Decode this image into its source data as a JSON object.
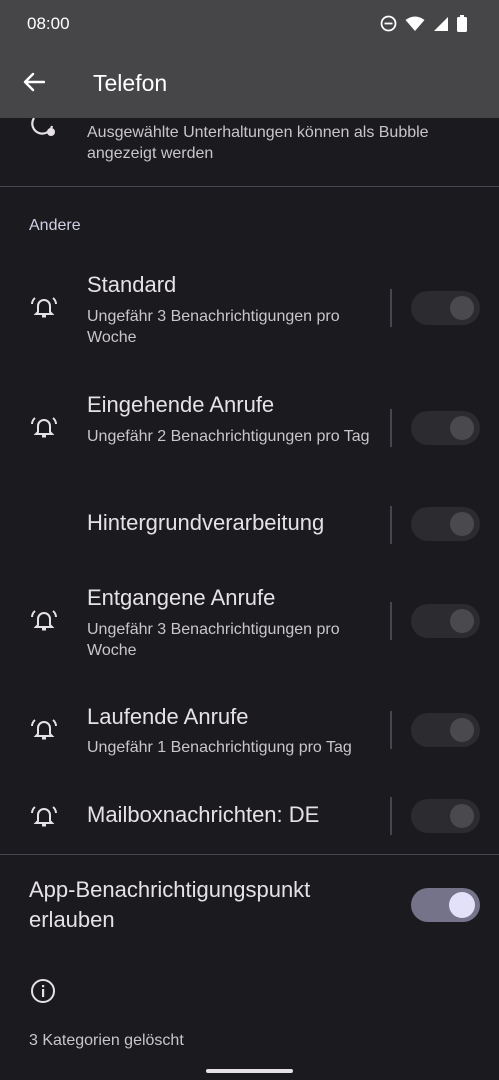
{
  "status_bar": {
    "time": "08:00",
    "icons": [
      "do-not-disturb-icon",
      "wifi-icon",
      "signal-icon",
      "battery-icon"
    ]
  },
  "app_bar": {
    "title": "Telefon",
    "back_icon": "arrow-back-icon"
  },
  "bubbles_row": {
    "icon": "bubble-icon",
    "text": "Ausgewählte Unterhaltungen können als Bubble angezeigt werden"
  },
  "section": {
    "header": "Andere"
  },
  "channels": [
    {
      "icon": "bell-icon",
      "title": "Standard",
      "subtitle": "Ungefähr 3 Benachrichtigungen pro Woche",
      "enabled": false
    },
    {
      "icon": "bell-icon",
      "title": "Eingehende Anrufe",
      "subtitle": "Ungefähr 2 Benachrichtigungen pro Tag",
      "enabled": false
    },
    {
      "icon": "",
      "title": "Hintergrundverarbeitung",
      "subtitle": "",
      "enabled": false
    },
    {
      "icon": "bell-icon",
      "title": "Entgangene Anrufe",
      "subtitle": "Ungefähr 3 Benachrichtigungen pro Woche",
      "enabled": false
    },
    {
      "icon": "bell-icon",
      "title": "Laufende Anrufe",
      "subtitle": "Ungefähr 1 Benachrichtigung pro Tag",
      "enabled": false
    },
    {
      "icon": "bell-icon",
      "title": "Mailboxnachrichten: DE",
      "subtitle": "",
      "enabled": false
    }
  ],
  "notification_dot": {
    "title": "App-Benachrichtigungspunkt erlauben",
    "enabled": true
  },
  "footer": {
    "info_icon": "info-icon",
    "text": "3 Kategorien gelöscht"
  },
  "colors": {
    "background": "#1b1b1f",
    "app_bar": "#464649",
    "accent_toggle_on": "#74738a",
    "section_header": "#d0cfe6"
  }
}
